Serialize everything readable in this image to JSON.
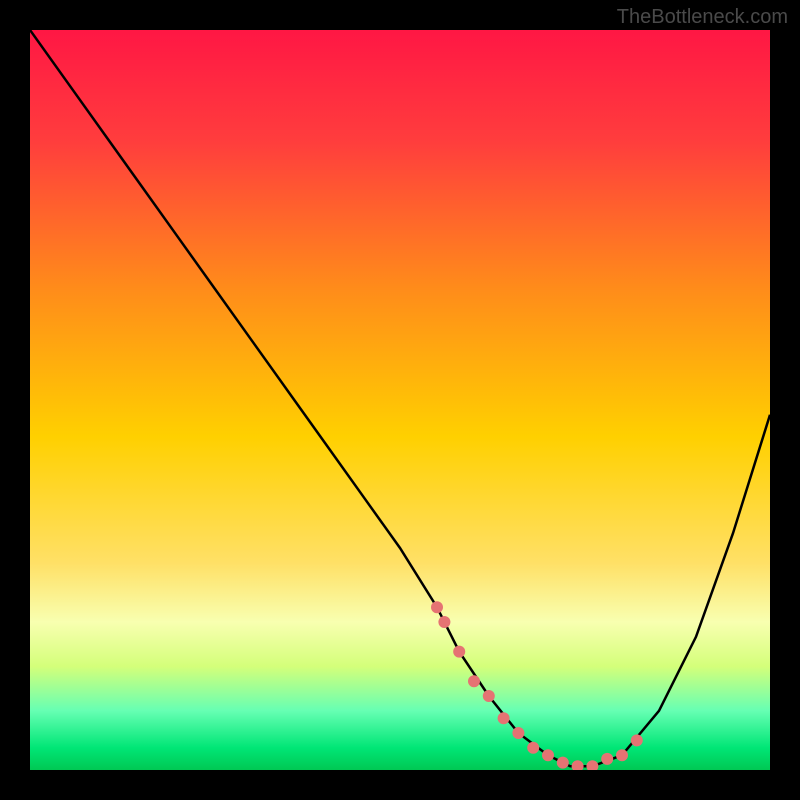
{
  "watermark": "TheBottleneck.com",
  "chart_data": {
    "type": "line",
    "title": "",
    "xlabel": "",
    "ylabel": "",
    "xlim": [
      0,
      100
    ],
    "ylim": [
      0,
      100
    ],
    "gradient_stops": [
      {
        "offset": 0,
        "color": "#ff1744"
      },
      {
        "offset": 15,
        "color": "#ff3d3d"
      },
      {
        "offset": 35,
        "color": "#ff8c1a"
      },
      {
        "offset": 55,
        "color": "#ffd000"
      },
      {
        "offset": 72,
        "color": "#ffe066"
      },
      {
        "offset": 80,
        "color": "#f8ffb0"
      },
      {
        "offset": 86,
        "color": "#d4ff7a"
      },
      {
        "offset": 92,
        "color": "#66ffb3"
      },
      {
        "offset": 97,
        "color": "#00e676"
      },
      {
        "offset": 100,
        "color": "#00c853"
      }
    ],
    "series": [
      {
        "name": "curve",
        "x": [
          0,
          5,
          10,
          15,
          20,
          25,
          30,
          35,
          40,
          45,
          50,
          55,
          58,
          62,
          66,
          70,
          73,
          76,
          80,
          85,
          90,
          95,
          100
        ],
        "y": [
          100,
          93,
          86,
          79,
          72,
          65,
          58,
          51,
          44,
          37,
          30,
          22,
          16,
          10,
          5,
          2,
          0.5,
          0.5,
          2,
          8,
          18,
          32,
          48
        ]
      }
    ],
    "scatter": {
      "name": "points",
      "color": "#e57373",
      "x": [
        55,
        56,
        58,
        60,
        62,
        64,
        66,
        68,
        70,
        72,
        74,
        76,
        78,
        80,
        82
      ],
      "y": [
        22,
        20,
        16,
        12,
        10,
        7,
        5,
        3,
        2,
        1,
        0.5,
        0.5,
        1.5,
        2,
        4
      ]
    }
  }
}
